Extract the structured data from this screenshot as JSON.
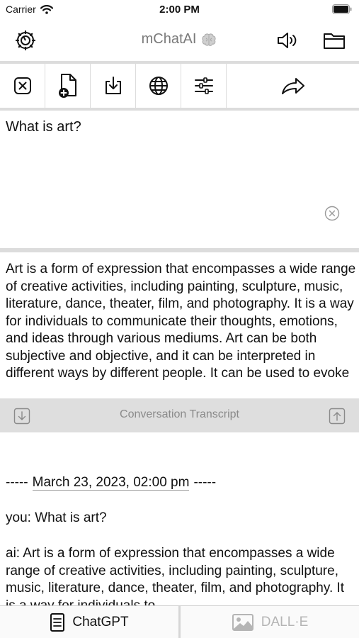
{
  "status_bar": {
    "carrier": "Carrier",
    "time": "2:00 PM"
  },
  "nav": {
    "title": "mChatAI",
    "left_icon": "settings-icon",
    "right_icons": [
      "speaker-icon",
      "folder-icon"
    ]
  },
  "toolbar": {
    "items": [
      "clear-icon",
      "new-document-icon",
      "download-icon",
      "globe-icon",
      "sliders-icon",
      "share-arrow-icon"
    ]
  },
  "prompt": {
    "text": "What is art?"
  },
  "response": {
    "text": "Art is a form of expression that encompasses a wide range of creative activities, including painting, sculpture, music, literature, dance, theater, film, and photography. It is a way for individuals to communicate their thoughts, emotions, and ideas through various mediums. Art can be both subjective and objective, and it can be interpreted in different ways by different people. It can be used to evoke"
  },
  "transcript": {
    "title": "Conversation Transcript",
    "dashes": "-----",
    "date": "March 23, 2023, 02:00 pm",
    "you_line": "you: What is art?",
    "ai_line": "ai: Art is a form of expression that encompasses a wide range of creative activities, including painting, sculpture, music, literature, dance, theater, film, and photography. It is a way for individuals to"
  },
  "tabs": [
    {
      "label": "ChatGPT",
      "active": true
    },
    {
      "label": "DALL·E",
      "active": false
    }
  ],
  "colors": {
    "divider": "#dcdcdc",
    "transcript_bar": "#dedede",
    "muted": "#8a8a8a"
  }
}
